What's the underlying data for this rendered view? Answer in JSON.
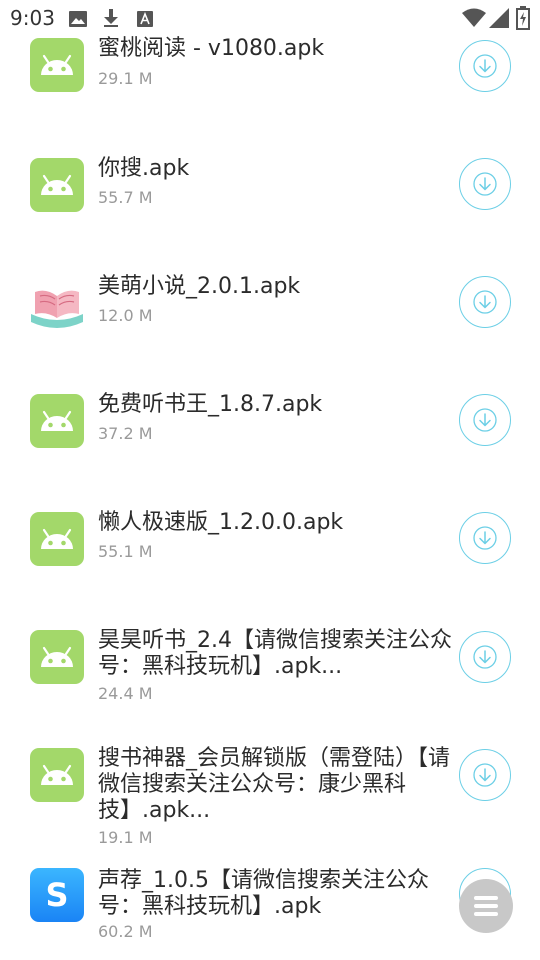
{
  "status_bar": {
    "time": "9:03",
    "left_icons": [
      "image-icon",
      "download-icon",
      "font-icon"
    ],
    "right_icons": [
      "wifi-icon",
      "signal-icon",
      "battery-charging-icon"
    ]
  },
  "colors": {
    "android_icon_bg": "#a3d86a",
    "download_ring": "#6ccfe6",
    "title_text": "#2b2b2b",
    "size_text": "#9a9a9a",
    "fab_bg": "#c8c8c8"
  },
  "download_list": {
    "items": [
      {
        "title": "蜜桃阅读 - v1080.apk",
        "size": "29.1 M",
        "icon": "android-icon"
      },
      {
        "title": "你搜.apk",
        "size": "55.7 M",
        "icon": "android-icon"
      },
      {
        "title": "美萌小说_2.0.1.apk",
        "size": "12.0 M",
        "icon": "book-icon"
      },
      {
        "title": "免费听书王_1.8.7.apk",
        "size": "37.2 M",
        "icon": "android-icon"
      },
      {
        "title": "懒人极速版_1.2.0.0.apk",
        "size": "55.1 M",
        "icon": "android-icon"
      },
      {
        "title": "昊昊听书_2.4【请微信搜索关注公众号：黑科技玩机】.apk...",
        "size": "24.4 M",
        "icon": "android-icon"
      },
      {
        "title": "搜书神器_会员解锁版（需登陆）【请微信搜索关注公众号：康少黑科技】.apk...",
        "size": "19.1 M",
        "icon": "android-icon"
      },
      {
        "title": "声荐_1.0.5【请微信搜索关注公众号：黑科技玩机】.apk",
        "size": "60.2 M",
        "icon": "s-app-icon",
        "icon_letter": "S"
      }
    ]
  },
  "fab": {
    "icon": "menu-icon"
  }
}
